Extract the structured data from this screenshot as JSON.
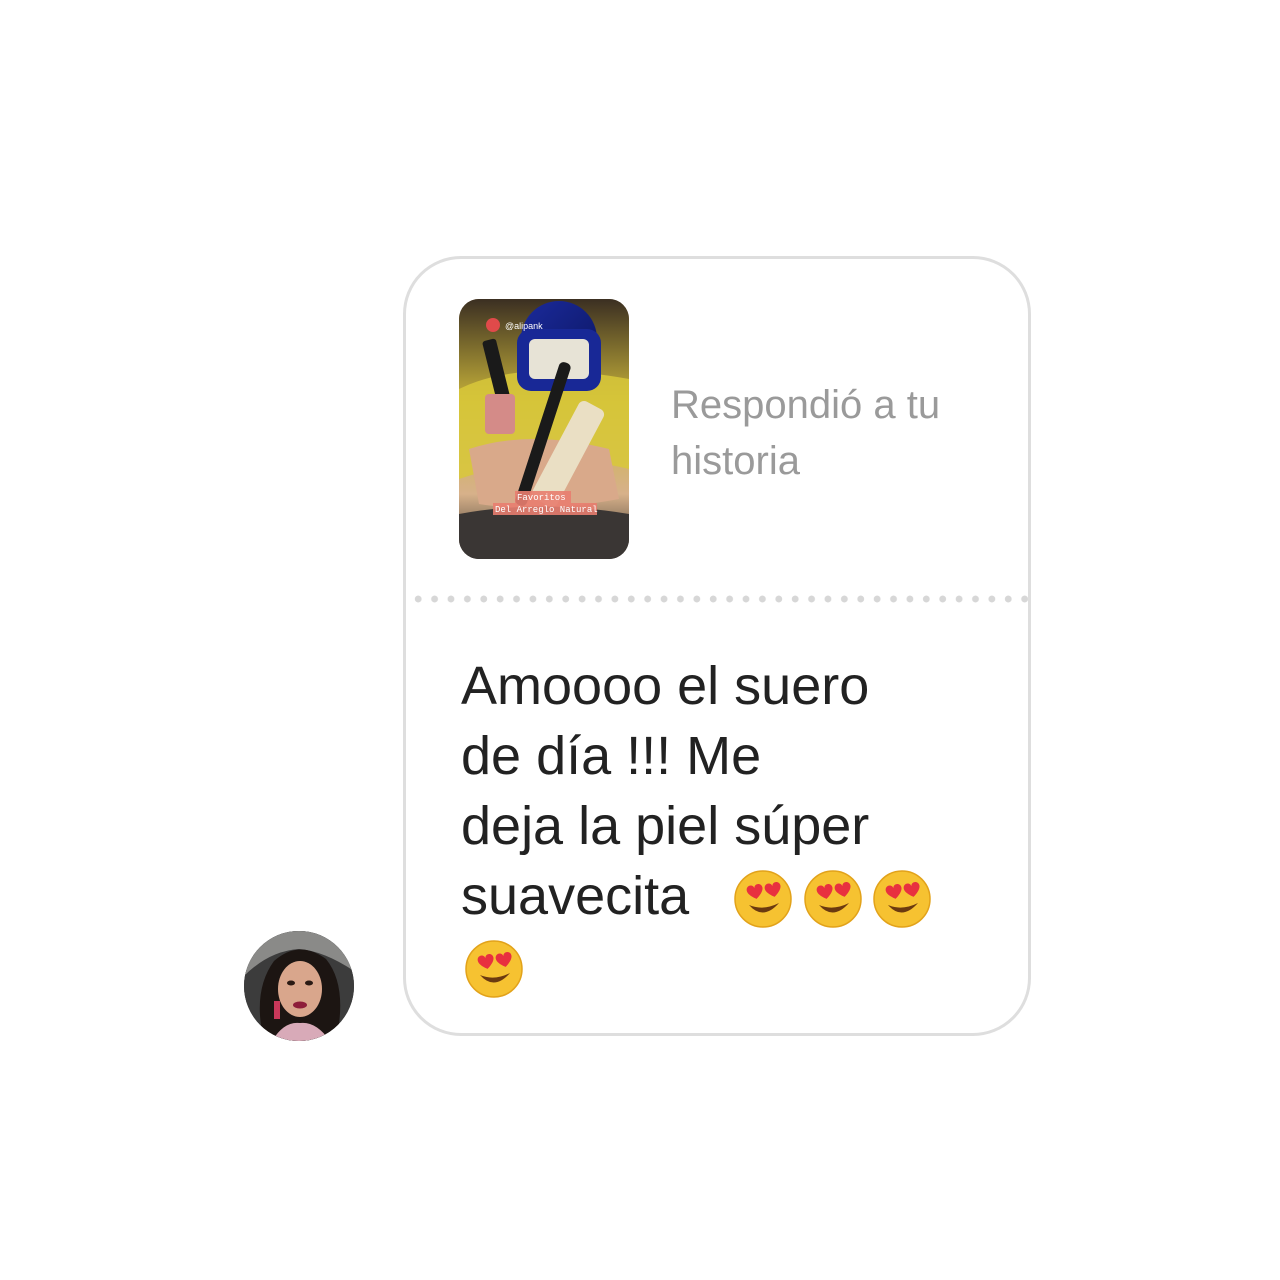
{
  "reply": {
    "label": "Respondió a tu historia"
  },
  "story": {
    "username": "@alipank",
    "caption_line1": "Favoritos",
    "caption_line2": "Del Arreglo Natural"
  },
  "message": {
    "text": "Amoooo el suero\nde día !!! Me\ndeja la piel súper\nsuavecita",
    "emoji": [
      "heart-eyes-emoji",
      "heart-eyes-emoji",
      "heart-eyes-emoji",
      "heart-eyes-emoji"
    ]
  },
  "colors": {
    "bubble_border": "#dedede",
    "label_gray": "#9a9a9a",
    "text_dark": "#222222",
    "emoji_yellow": "#f6c231",
    "heart_red": "#e8303f"
  }
}
